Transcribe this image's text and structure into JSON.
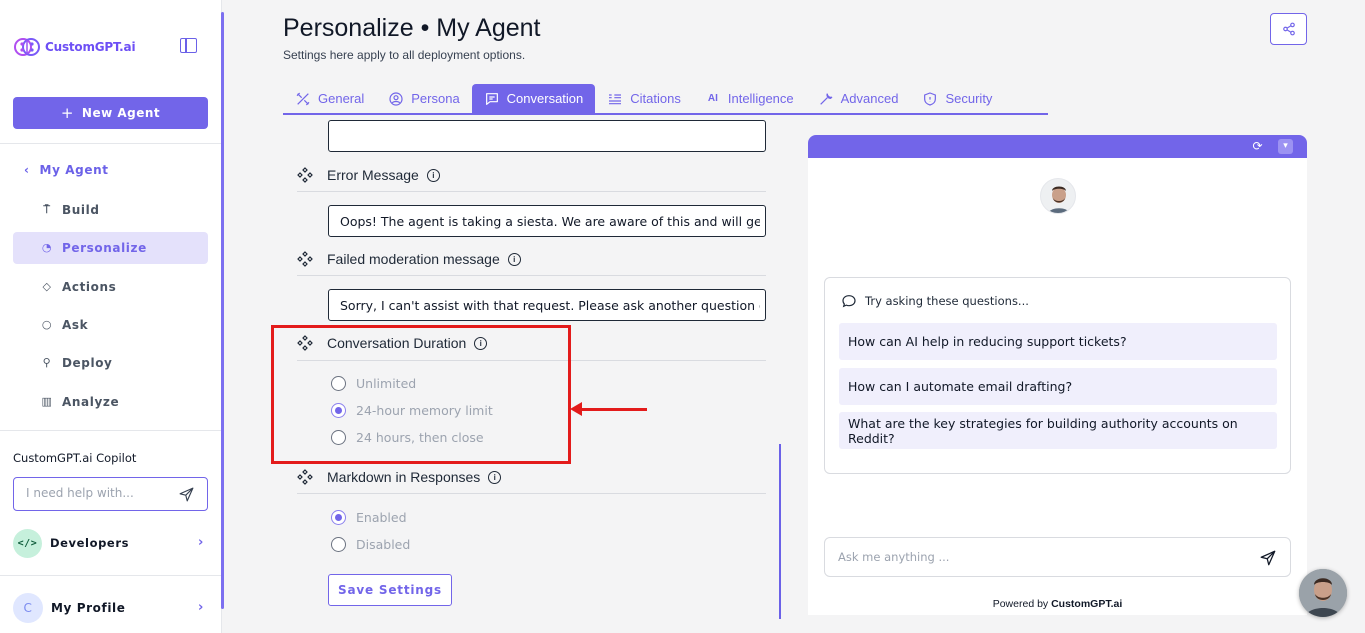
{
  "app": {
    "brand": "CustomGPT.ai",
    "accent_color": "#7265e9",
    "highlight_color": "#e31b1b"
  },
  "sidebar": {
    "new_agent_label": "New Agent",
    "parent_label": "My Agent",
    "items": [
      {
        "label": "Build",
        "icon": "build-icon",
        "active": false
      },
      {
        "label": "Personalize",
        "icon": "palette-icon",
        "active": true
      },
      {
        "label": "Actions",
        "icon": "actions-icon",
        "active": false
      },
      {
        "label": "Ask",
        "icon": "chat-icon",
        "active": false
      },
      {
        "label": "Deploy",
        "icon": "rocket-icon",
        "active": false
      },
      {
        "label": "Analyze",
        "icon": "chart-icon",
        "active": false
      }
    ],
    "copilot_label": "CustomGPT.ai Copilot",
    "copilot_placeholder": "I need help with...",
    "developers_label": "Developers",
    "profile_label": "My Profile",
    "profile_initial": "C"
  },
  "header": {
    "title": "Personalize • My Agent",
    "subtitle": "Settings here apply to all deployment options."
  },
  "tabs": [
    {
      "label": "General",
      "icon": "tools-icon",
      "active": false
    },
    {
      "label": "Persona",
      "icon": "user-circle-icon",
      "active": false
    },
    {
      "label": "Conversation",
      "icon": "message-icon",
      "active": true
    },
    {
      "label": "Citations",
      "icon": "quote-icon",
      "active": false
    },
    {
      "label": "Intelligence",
      "icon": "ai-icon",
      "active": false
    },
    {
      "label": "Advanced",
      "icon": "wrench-icon",
      "active": false
    },
    {
      "label": "Security",
      "icon": "shield-icon",
      "active": false
    }
  ],
  "settings": {
    "error_message": {
      "label": "Error Message",
      "value": "Oops! The agent is taking a siesta. We are aware of this and will get"
    },
    "failed_moderation": {
      "label": "Failed moderation message",
      "value": "Sorry, I can't assist with that request. Please ask another question o"
    },
    "conversation_duration": {
      "label": "Conversation Duration",
      "options": [
        "Unlimited",
        "24-hour memory limit",
        "24 hours, then close"
      ],
      "selected": "24-hour memory limit"
    },
    "markdown": {
      "label": "Markdown in Responses",
      "options": [
        "Enabled",
        "Disabled"
      ],
      "selected": "Enabled"
    },
    "save_label": "Save Settings"
  },
  "preview": {
    "suggestions_heading": "Try asking these questions...",
    "suggestions": [
      "How can AI help in reducing support tickets?",
      "How can I automate email drafting?",
      "What are the key strategies for building authority accounts on Reddit?"
    ],
    "ask_placeholder": "Ask me anything ...",
    "powered_prefix": "Powered by",
    "powered_brand": "CustomGPT.ai"
  }
}
